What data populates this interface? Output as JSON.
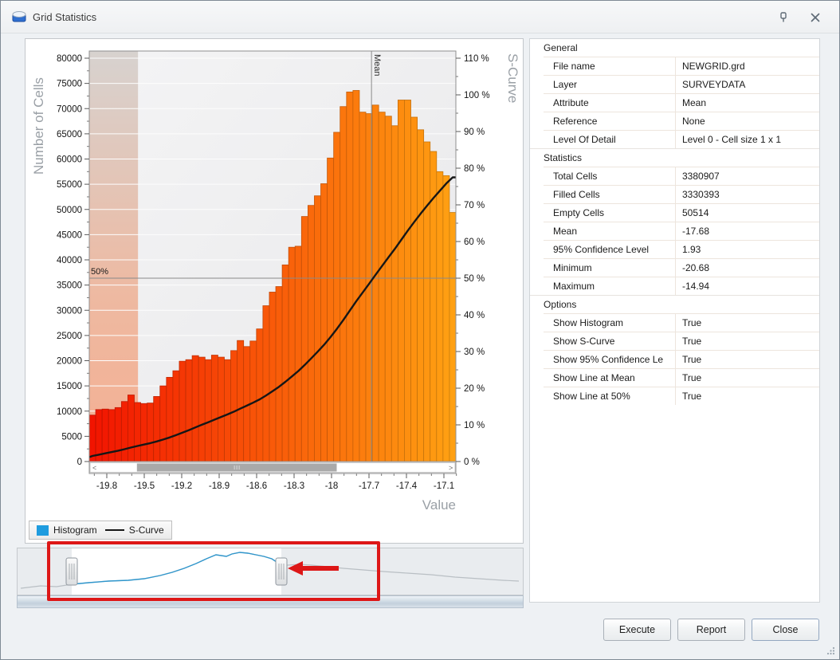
{
  "window": {
    "title": "Grid Statistics"
  },
  "icons": {
    "app": "grid-statistics-icon",
    "pin": "pin-icon",
    "close": "close-icon"
  },
  "chart_data": {
    "type": "bar",
    "subtype": "histogram-with-s-curve",
    "xlabel": "Value",
    "ylabel_left": "Number of Cells",
    "ylabel_right": "S-Curve",
    "x_tick_labels": [
      "-19.8",
      "-19.5",
      "-19.2",
      "-18.9",
      "-18.6",
      "-18.3",
      "-18",
      "-17.7",
      "-17.4",
      "-17.1"
    ],
    "x_axis_range": [
      -19.94,
      -17.0
    ],
    "y_left_axis": {
      "min": 0,
      "max": 80000,
      "step": 5000
    },
    "y_right_axis": {
      "min": 0,
      "max": 110,
      "step": 10,
      "unit": "%"
    },
    "bars": [
      9200,
      10300,
      10400,
      10300,
      10700,
      11900,
      13200,
      11700,
      11500,
      11600,
      12900,
      15000,
      16700,
      18000,
      19900,
      20200,
      21000,
      20700,
      20200,
      21100,
      20700,
      20200,
      22000,
      24000,
      22800,
      23900,
      26300,
      30900,
      33600,
      34700,
      39000,
      42500,
      42700,
      48600,
      50800,
      52700,
      55100,
      60200,
      65300,
      70400,
      73300,
      73600,
      69300,
      69000,
      70700,
      69300,
      68500,
      66600,
      71700,
      71700,
      68300,
      65800,
      63400,
      61500,
      57500,
      56700,
      49400
    ],
    "bar_color_start": "#f21400",
    "bar_color_end": "#ffa012",
    "s_curve": {
      "start_pct": 1.2,
      "end_pct": 77.5,
      "color": "#161616"
    },
    "mean": {
      "value": -17.68,
      "label": "Mean"
    },
    "line_50": {
      "pct": 50,
      "label": "50%"
    },
    "confidence_band": {
      "from": -19.94,
      "to": -19.55
    },
    "scrollbar": {
      "thumb_start": 0.13,
      "thumb_end": 0.675
    },
    "legend": [
      {
        "label": "Histogram",
        "color": "#1f9cdf"
      },
      {
        "label": "S-Curve",
        "color": "#161616"
      }
    ]
  },
  "navigator": {
    "selection_start": 69,
    "selection_end": 332,
    "curve_color_selected": "#2f96cc",
    "curve_color_unselected": "#b9bfc4",
    "points": [
      [
        5,
        51
      ],
      [
        30,
        48
      ],
      [
        50,
        49
      ],
      [
        69,
        46
      ],
      [
        90,
        44
      ],
      [
        115,
        42
      ],
      [
        140,
        41
      ],
      [
        160,
        39
      ],
      [
        180,
        35
      ],
      [
        195,
        31
      ],
      [
        210,
        26
      ],
      [
        225,
        20
      ],
      [
        238,
        14
      ],
      [
        250,
        9
      ],
      [
        263,
        11
      ],
      [
        270,
        8
      ],
      [
        280,
        6
      ],
      [
        290,
        7
      ],
      [
        300,
        9
      ],
      [
        310,
        11
      ],
      [
        320,
        14
      ],
      [
        332,
        22
      ],
      [
        340,
        22
      ],
      [
        355,
        21
      ],
      [
        370,
        22
      ],
      [
        390,
        24
      ],
      [
        410,
        26
      ],
      [
        435,
        28
      ],
      [
        460,
        30
      ],
      [
        490,
        32
      ],
      [
        520,
        34
      ],
      [
        550,
        37
      ],
      [
        580,
        39
      ],
      [
        610,
        41
      ],
      [
        630,
        42
      ]
    ]
  },
  "annotation": {
    "color": "#dd1717"
  },
  "property_grid": {
    "sections": [
      {
        "title": "General",
        "rows": [
          [
            "File name",
            "NEWGRID.grd"
          ],
          [
            "Layer",
            "SURVEYDATA"
          ],
          [
            "Attribute",
            "Mean"
          ],
          [
            "Reference",
            "None"
          ],
          [
            "Level Of Detail",
            "Level 0 - Cell size 1 x 1"
          ]
        ]
      },
      {
        "title": "Statistics",
        "rows": [
          [
            "Total Cells",
            "3380907"
          ],
          [
            "Filled Cells",
            "3330393"
          ],
          [
            "Empty Cells",
            "50514"
          ],
          [
            "Mean",
            "-17.68"
          ],
          [
            "95% Confidence Level",
            "1.93"
          ],
          [
            "Minimum",
            "-20.68"
          ],
          [
            "Maximum",
            "-14.94"
          ]
        ]
      },
      {
        "title": "Options",
        "rows": [
          [
            "Show Histogram",
            "True"
          ],
          [
            "Show S-Curve",
            "True"
          ],
          [
            "Show 95% Confidence Le",
            "True"
          ],
          [
            "Show Line at Mean",
            "True"
          ],
          [
            "Show Line at 50%",
            "True"
          ]
        ]
      }
    ]
  },
  "buttons": [
    {
      "label": "Execute"
    },
    {
      "label": "Report"
    },
    {
      "label": "Close"
    }
  ]
}
